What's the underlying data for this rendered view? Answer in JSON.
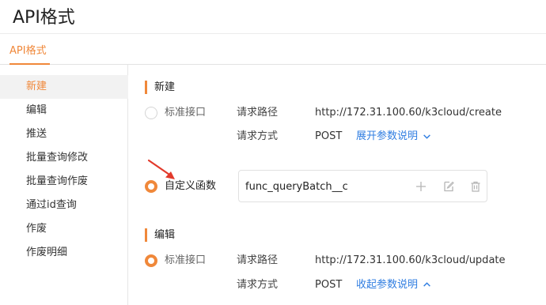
{
  "header": {
    "title": "API格式"
  },
  "tabs": [
    {
      "label": "API格式",
      "active": true
    }
  ],
  "sidebar": {
    "items": [
      {
        "label": "新建",
        "active": true
      },
      {
        "label": "编辑",
        "active": false
      },
      {
        "label": "推送",
        "active": false
      },
      {
        "label": "批量查询修改",
        "active": false
      },
      {
        "label": "批量查询作废",
        "active": false
      },
      {
        "label": "通过id查询",
        "active": false
      },
      {
        "label": "作废",
        "active": false
      },
      {
        "label": "作废明细",
        "active": false
      }
    ]
  },
  "sections": {
    "create": {
      "title": "新建",
      "option_standard": "标准接口",
      "option_custom": "自定义函数",
      "selected": "custom",
      "path_label": "请求路径",
      "path_value": "http://172.31.100.60/k3cloud/create",
      "method_label": "请求方式",
      "method_value": "POST",
      "params_toggle": "展开参数说明",
      "function_name": "func_queryBatch__c"
    },
    "edit": {
      "title": "编辑",
      "option_standard": "标准接口",
      "selected": "standard",
      "path_label": "请求路径",
      "path_value": "http://172.31.100.60/k3cloud/update",
      "method_label": "请求方式",
      "method_value": "POST",
      "params_toggle": "收起参数说明"
    }
  },
  "icons": {
    "add": "plus-icon",
    "edit": "edit-icon",
    "delete": "trash-icon",
    "expand": "chevron-down-icon",
    "collapse": "chevron-up-icon"
  },
  "colors": {
    "accent": "#f0883a",
    "link": "#2f7de1",
    "annotation_arrow": "#e23a2b"
  }
}
